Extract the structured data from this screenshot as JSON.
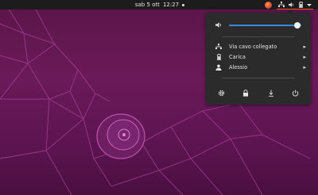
{
  "topbar": {
    "date": "sab 5 ott",
    "time": "12:27"
  },
  "tray": {
    "icons": [
      "app-icon",
      "network-icon",
      "volume-icon",
      "battery-icon",
      "dropdown-arrow-icon"
    ]
  },
  "menu": {
    "volume_level": 0.95,
    "items": [
      {
        "label": "Via cavo collegato",
        "icon": "network-icon"
      },
      {
        "label": "Carica",
        "icon": "battery-icon"
      },
      {
        "label": "Alessio",
        "icon": "user-icon"
      }
    ],
    "actions": [
      "settings-icon",
      "lock-icon",
      "rotation-lock-icon",
      "power-icon"
    ]
  },
  "colors": {
    "accent": "#e95420",
    "slider": "#3c8bd8",
    "panel": "#2b2b2b",
    "topbar": "#1c1c1c",
    "wallpaper": "#5c1450"
  }
}
